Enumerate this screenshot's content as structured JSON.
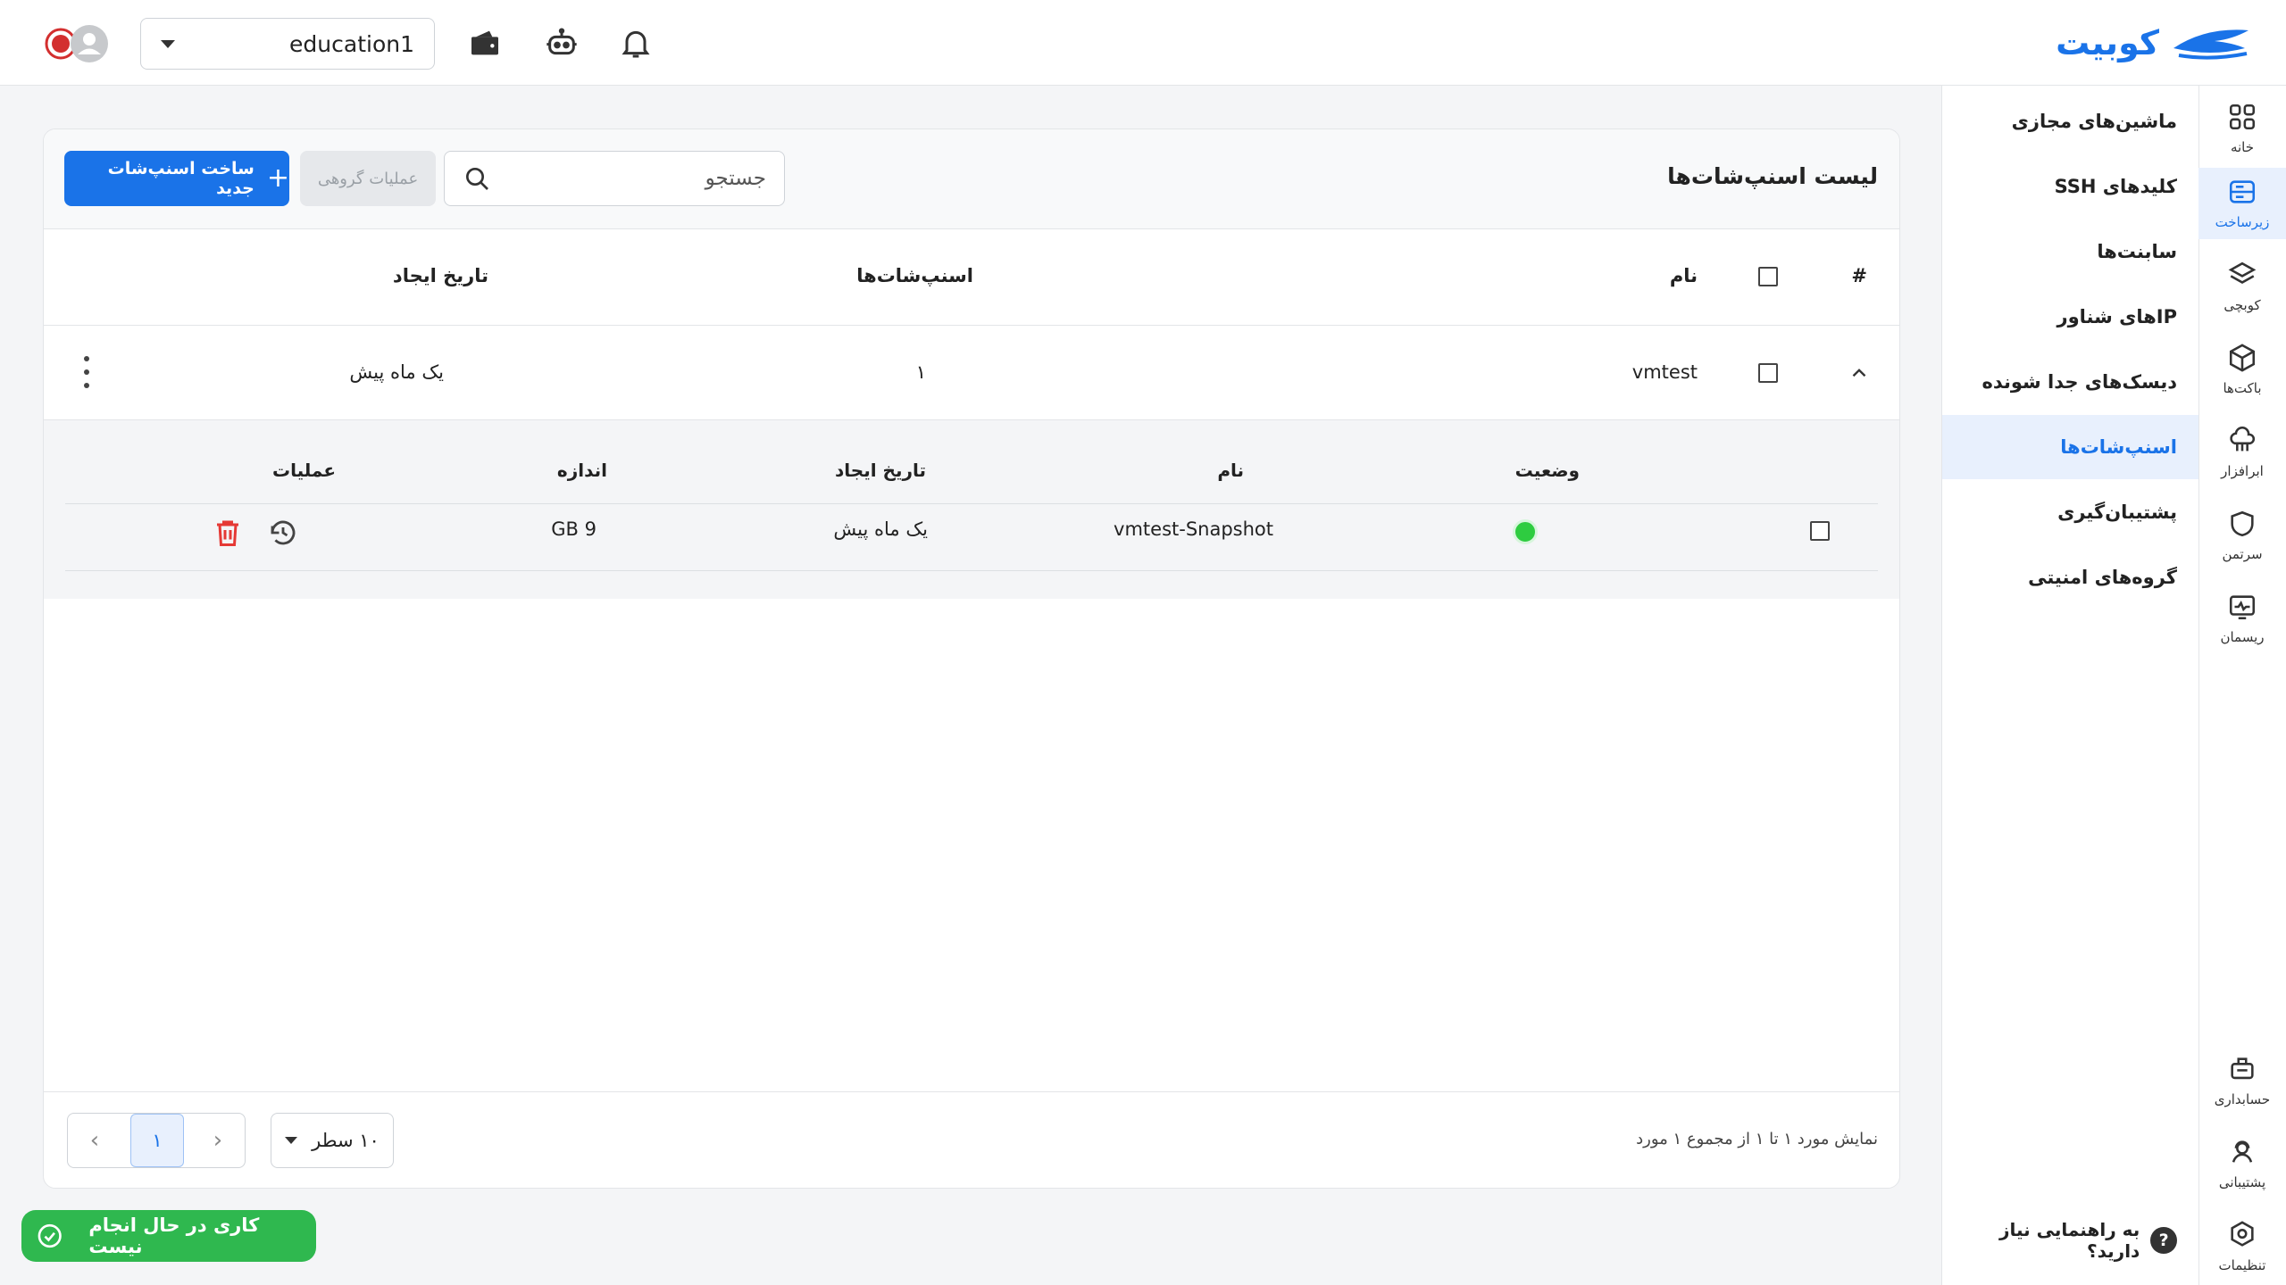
{
  "header": {
    "logo_text": "کوبیت",
    "project_value": "education1",
    "icons": [
      "bell-icon",
      "robot-icon",
      "wallet-icon",
      "avatar-icon"
    ]
  },
  "rail": {
    "items": [
      {
        "label": "خانه",
        "icon": "grid-icon"
      },
      {
        "label": "زیرساخت",
        "icon": "server-icon",
        "active": true
      },
      {
        "label": "کوبچی",
        "icon": "layers-icon"
      },
      {
        "label": "باکت‌ها",
        "icon": "box-icon"
      },
      {
        "label": "ابرافزار",
        "icon": "cloud-app-icon"
      },
      {
        "label": "سرتمن",
        "icon": "shield-icon"
      },
      {
        "label": "ریسمان",
        "icon": "monitor-icon"
      },
      {
        "label": "حسابداری",
        "icon": "accounting-icon"
      },
      {
        "label": "پشتیبانی",
        "icon": "support-icon"
      },
      {
        "label": "تنظیمات",
        "icon": "settings-icon"
      }
    ]
  },
  "subnav": {
    "items": [
      {
        "label": "ماشین‌های مجازی"
      },
      {
        "label": "کلیدهای SSH"
      },
      {
        "label": "سابنت‌ها"
      },
      {
        "label": "IPهای شناور"
      },
      {
        "label": "دیسک‌های جدا شونده"
      },
      {
        "label": "اسنپ‌شات‌ها",
        "active": true
      },
      {
        "label": "پشتیبان‌گیری"
      },
      {
        "label": "گروه‌های امنیتی"
      }
    ],
    "help_text": "به راهنمایی نیاز دارید؟",
    "help_mark": "?"
  },
  "card": {
    "title": "لیست اسنپ‌شات‌ها",
    "search_placeholder": "جستجو",
    "group_actions_label": "عملیات گروهی",
    "create_label": "ساخت اسنپ‌شات جدید",
    "create_plus": "+"
  },
  "table": {
    "headers": {
      "index": "#",
      "name": "نام",
      "snapshots": "اسنپ‌شات‌ها",
      "created": "تاریخ ایجاد"
    },
    "rows": [
      {
        "name": "vmtest",
        "snapshots": "۱",
        "created": "یک ماه پیش"
      }
    ]
  },
  "subtable": {
    "headers": {
      "status": "وضعیت",
      "name": "نام",
      "created": "تاریخ ایجاد",
      "size": "اندازه",
      "actions": "عملیات"
    },
    "rows": [
      {
        "status_color": "#2ecc40",
        "name": "vmtest-Snapshot",
        "created": "یک ماه پیش",
        "size": "9 GB"
      }
    ]
  },
  "footer": {
    "range_text": "نمایش مورد ۱ تا ۱ از مجموع ۱ مورد",
    "rows_per_page": "۱۰ سطر",
    "current_page": "۱"
  },
  "toast": {
    "text": "کاری در حال انجام نیست"
  },
  "colors": {
    "accent": "#1a73e8",
    "success": "#2fb84f",
    "danger": "#e53935"
  }
}
